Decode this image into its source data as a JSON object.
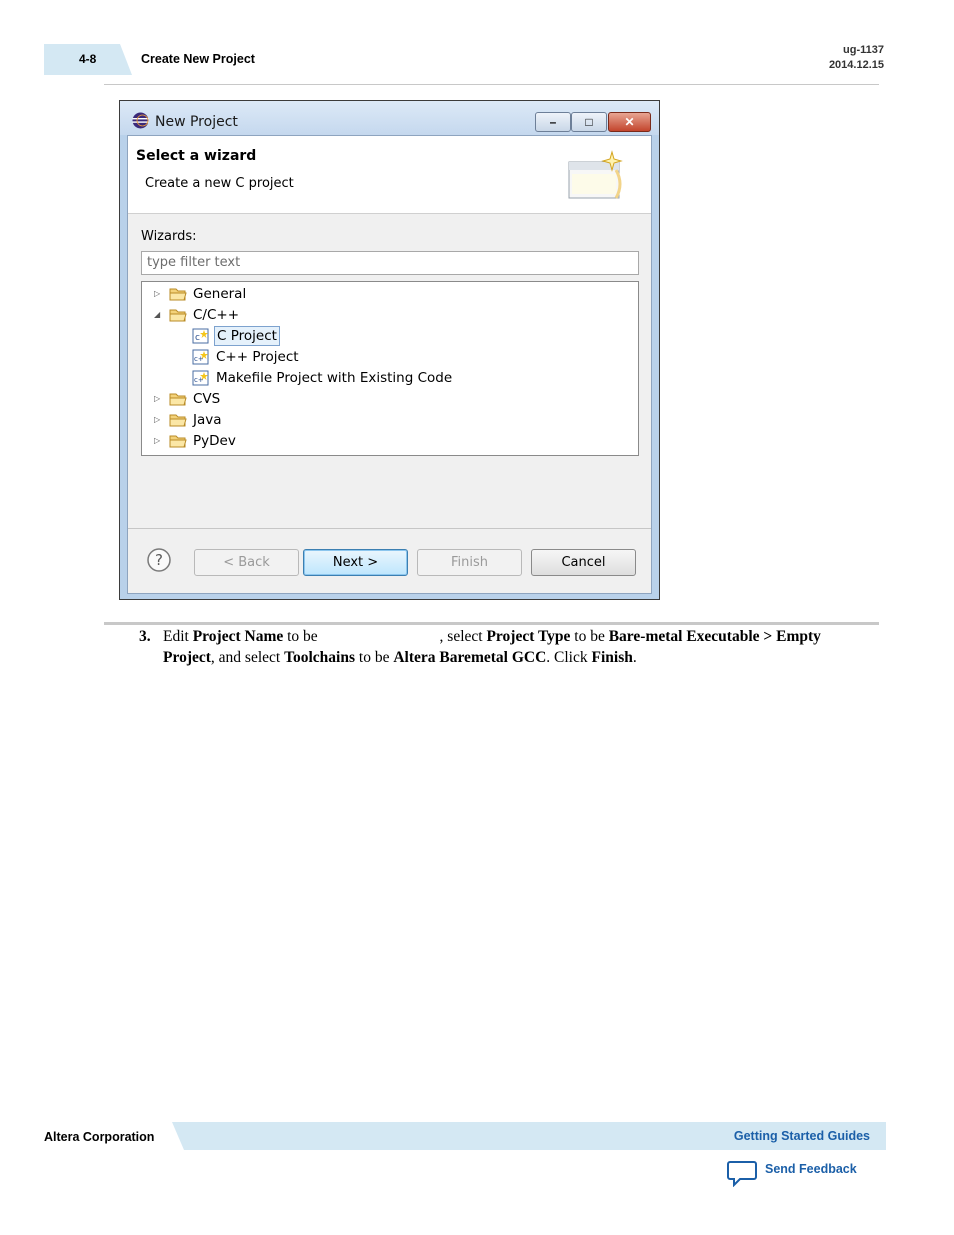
{
  "header": {
    "page_number": "4-8",
    "section_title": "Create New Project",
    "doc_id": "ug-1137",
    "doc_date": "2014.12.15"
  },
  "dialog": {
    "window_title": "New Project",
    "banner_title": "Select a wizard",
    "banner_subtitle": "Create a new C project",
    "wizards_label": "Wizards:",
    "filter_placeholder": "type filter text",
    "tree": {
      "general": "General",
      "cc": "C/C++",
      "c_project": "C Project",
      "cpp_project": "C++ Project",
      "makefile_project": "Makefile Project with Existing Code",
      "cvs": "CVS",
      "java": "Java",
      "pydev": "PyDev"
    },
    "buttons": {
      "back": "< Back",
      "next": "Next >",
      "finish": "Finish",
      "cancel": "Cancel",
      "help": "?"
    },
    "window_buttons": {
      "minimize": "–",
      "maximize": "□",
      "close": "✕"
    }
  },
  "body": {
    "step_number": "3.",
    "t1": "Edit ",
    "b1": "Project Name",
    "t2": " to be ",
    "t3": ", select ",
    "b2": "Project Type",
    "t4": " to be ",
    "b3": "Bare-metal Executable > Empty Project",
    "t5": ", and select ",
    "b4": "Toolchains",
    "t6": " to be ",
    "b5": "Altera Baremetal GCC",
    "t7": ". Click ",
    "b6": "Finish",
    "t8": "."
  },
  "footer": {
    "company": "Altera Corporation",
    "guides": "Getting Started Guides",
    "feedback": "Send Feedback"
  },
  "colors": {
    "accent_blue": "#1b5fa8",
    "header_tab": "#d4e8f3",
    "footer_band": "#d4e8f3"
  }
}
